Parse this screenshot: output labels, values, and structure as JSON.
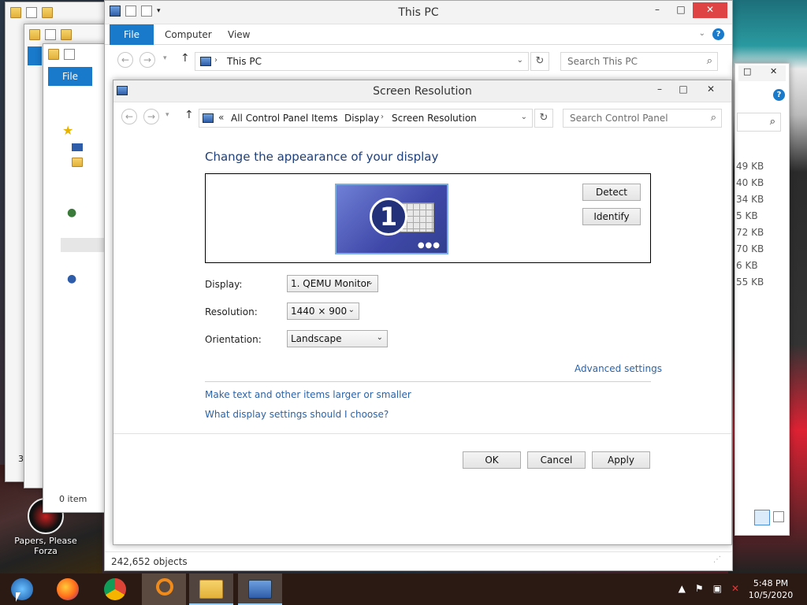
{
  "background_windows": {
    "file_tab": "File",
    "status_count_fragment": "3",
    "items_text": "0 item",
    "sizes": [
      "49 KB",
      "40 KB",
      "34 KB",
      "5 KB",
      "72 KB",
      "70 KB",
      "6 KB",
      "55 KB"
    ]
  },
  "this_pc": {
    "title": "This PC",
    "tabs": [
      "File",
      "Computer",
      "View"
    ],
    "address": "This PC",
    "search_placeholder": "Search This PC",
    "status": "242,652 objects"
  },
  "screen_resolution": {
    "title": "Screen Resolution",
    "breadcrumb": [
      "All Control Panel Items",
      "Display",
      "Screen Resolution"
    ],
    "breadcrumb_prefix": "«",
    "search_placeholder": "Search Control Panel",
    "heading": "Change the appearance of your display",
    "monitor_number": "1",
    "detect_label": "Detect",
    "identify_label": "Identify",
    "display_label": "Display:",
    "display_value": "1. QEMU Monitor",
    "resolution_label": "Resolution:",
    "resolution_value": "1440 × 900",
    "orientation_label": "Orientation:",
    "orientation_value": "Landscape",
    "advanced_link": "Advanced settings",
    "link_text_size": "Make text and other items larger or smaller",
    "link_help": "What display settings should I choose?",
    "ok_label": "OK",
    "cancel_label": "Cancel",
    "apply_label": "Apply"
  },
  "desktop": {
    "icon_label": "Papers, Please Forza"
  },
  "taskbar": {
    "apps": [
      "start-icon",
      "firefox-icon",
      "chrome-icon",
      "search-app-icon",
      "file-explorer-icon",
      "control-panel-icon"
    ],
    "time": "5:48 PM",
    "date": "10/5/2020"
  },
  "colors": {
    "accent": "#1979ca",
    "link": "#2a62a8",
    "heading": "#1e3f7a",
    "close": "#e04343"
  }
}
